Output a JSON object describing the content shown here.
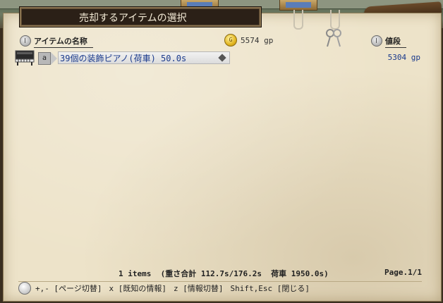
{
  "window": {
    "title": "売却するアイテムの選択"
  },
  "header": {
    "name_column": "アイテムの名称",
    "price_column": "値段",
    "gold_amount": "5574 gp",
    "gold_icon": "gold-coin-icon"
  },
  "items": [
    {
      "icon": "piano-icon",
      "slot": "a",
      "name": "39個の装飾ピアノ(荷車) 50.0s",
      "price": "5304 gp"
    }
  ],
  "footer": {
    "summary": "1 items  (重さ合計 112.7s/176.2s  荷車 1950.0s)",
    "page": "Page.1/1"
  },
  "help": {
    "icon": "lightbulb-icon",
    "keys": [
      "+,- [ページ切替]",
      "x [既知の情報]",
      "z [情報切替]",
      "Shift,Esc [閉じる]"
    ]
  }
}
